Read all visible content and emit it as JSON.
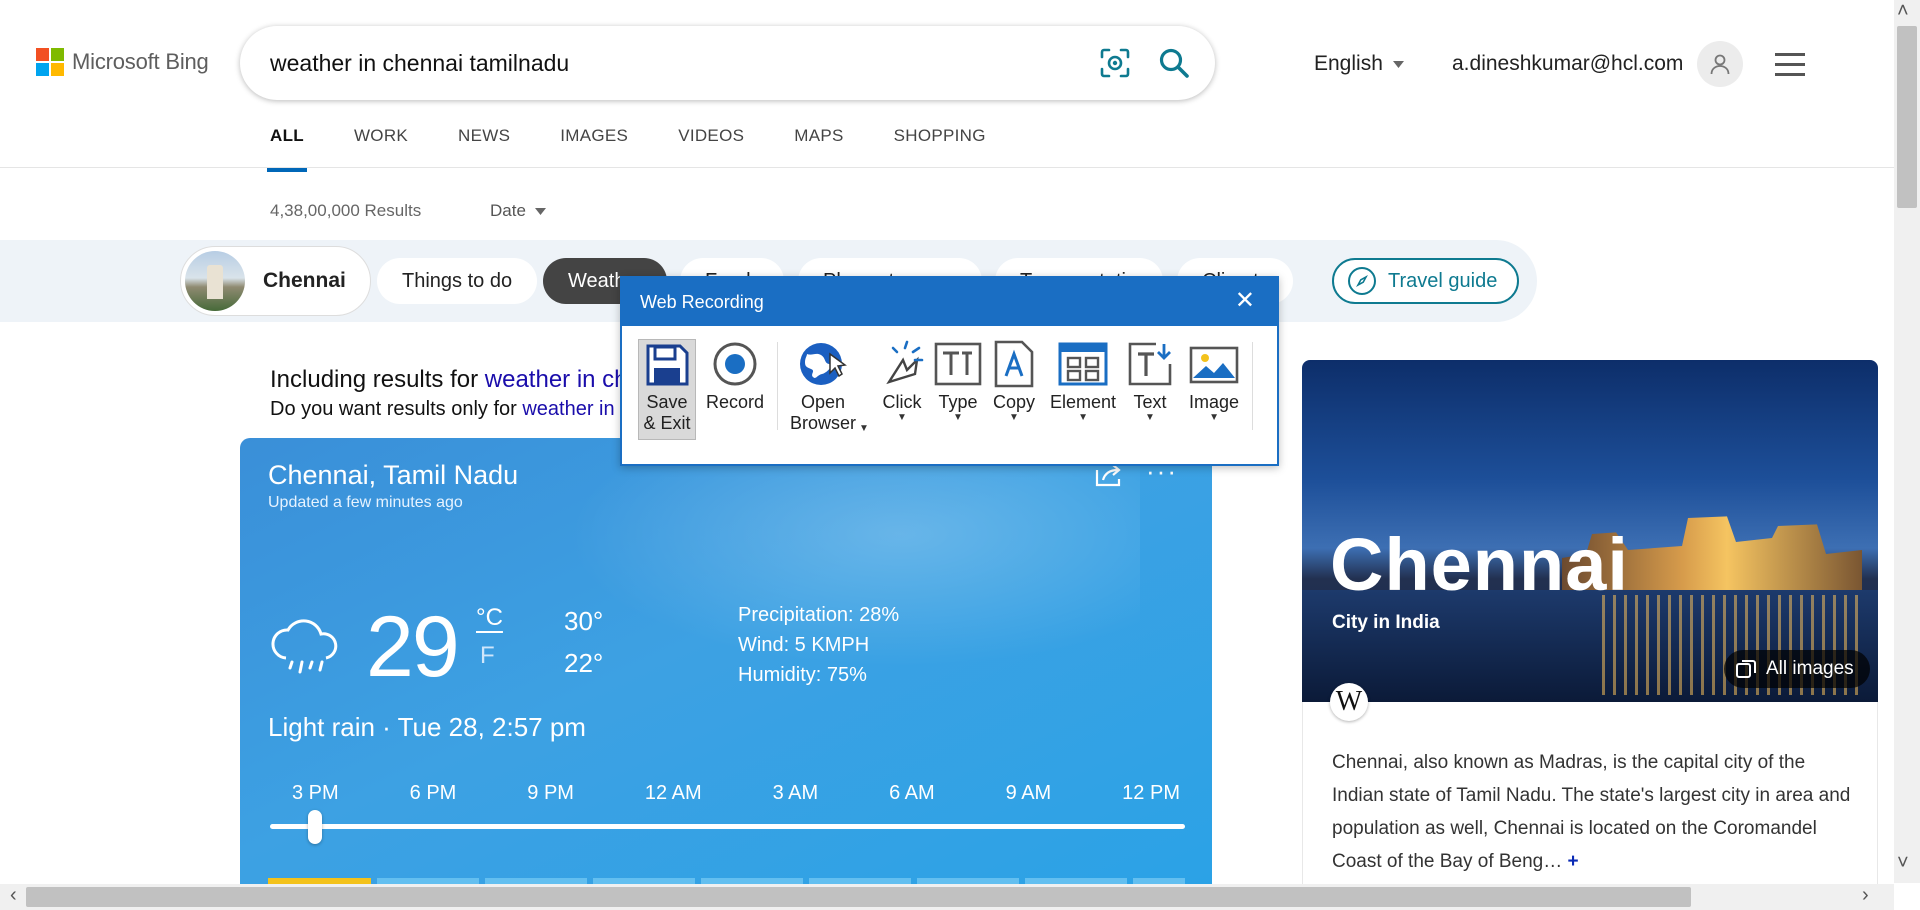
{
  "header": {
    "logo_text": "Microsoft Bing",
    "search_value": "weather in chennai tamilnadu",
    "language": "English",
    "user_email": "a.dineshkumar@hcl.com"
  },
  "tabs": [
    "ALL",
    "WORK",
    "NEWS",
    "IMAGES",
    "VIDEOS",
    "MAPS",
    "SHOPPING"
  ],
  "results": {
    "count": "4,38,00,000 Results",
    "date_filter": "Date"
  },
  "chips": {
    "city": "Chennai",
    "things": "Things to do",
    "weather": "Weather",
    "food": "Food",
    "places": "Places to go",
    "transport": "Transportation",
    "climate": "Climate",
    "travel_guide": "Travel guide"
  },
  "including": {
    "prefix": "Including results for ",
    "query": "weather in chennai tamil nadu",
    "only_prefix": "Do you want results only for ",
    "only_query": "weather in chennai tamilnadu"
  },
  "weather": {
    "location": "Chennai, Tamil Nadu",
    "updated": "Updated a few minutes ago",
    "temp": "29",
    "unit_c": "°C",
    "unit_f": "F",
    "high": "30°",
    "low": "22°",
    "precipitation": "Precipitation: 28%",
    "wind": "Wind: 5 KMPH",
    "humidity": "Humidity: 75%",
    "condition": "Light rain · Tue 28, 2:57 pm",
    "hours": [
      "3 PM",
      "6 PM",
      "9 PM",
      "12 AM",
      "3 AM",
      "6 AM",
      "9 AM",
      "12 PM"
    ]
  },
  "right_panel": {
    "title": "Chennai",
    "subtitle": "City in India",
    "all_images": "All images",
    "wiki": "W",
    "description": "Chennai, also known as Madras, is the capital city of the Indian state of Tamil Nadu. The state's largest city in area and population as well, Chennai is located on the Coromandel Coast of the Bay of Beng…",
    "more": "+"
  },
  "recorder": {
    "title": "Web Recording",
    "save_exit": "Save\n& Exit",
    "record": "Record",
    "open_browser": "Open\nBrowser",
    "click": "Click",
    "type": "Type",
    "copy": "Copy",
    "element": "Element",
    "text": "Text",
    "image": "Image"
  },
  "colors": {
    "accent": "#0067b8",
    "recorder_blue": "#1a6ec3",
    "link": "#1a0dab"
  }
}
